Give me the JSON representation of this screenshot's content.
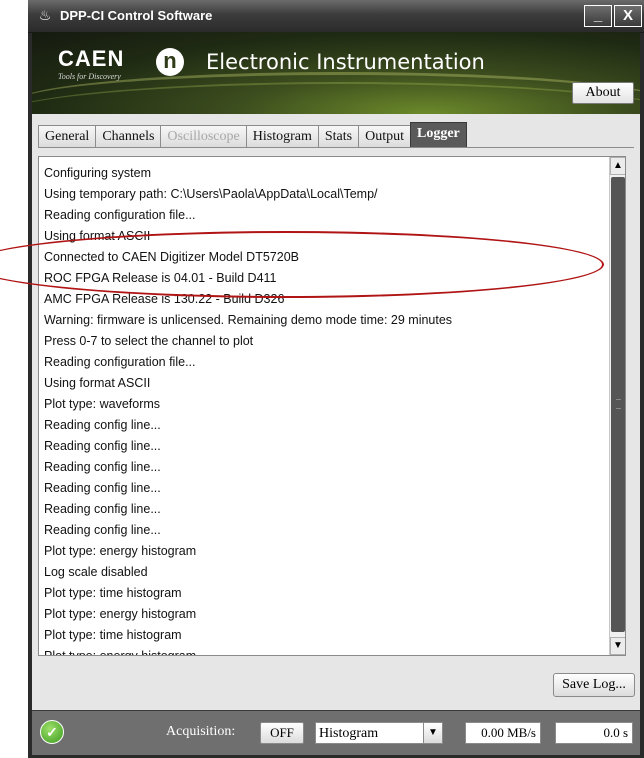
{
  "window": {
    "title": "DPP-CI Control Software",
    "icon": "caen-app-icon",
    "minimize_label": "_",
    "close_label": "X"
  },
  "banner": {
    "logo_text": "CAEN",
    "logo_tagline": "Tools for Discovery",
    "n_logo": "n",
    "title": "Electronic Instrumentation",
    "about_label": "About"
  },
  "tabs": [
    {
      "label": "General",
      "state": "normal"
    },
    {
      "label": "Channels",
      "state": "normal"
    },
    {
      "label": "Oscilloscope",
      "state": "disabled"
    },
    {
      "label": "Histogram",
      "state": "normal"
    },
    {
      "label": "Stats",
      "state": "normal"
    },
    {
      "label": "Output",
      "state": "normal"
    },
    {
      "label": "Logger",
      "state": "active"
    }
  ],
  "log": {
    "lines": [
      "Configuring system",
      "Using temporary path: C:\\Users\\Paola\\AppData\\Local\\Temp/",
      "Reading configuration file...",
      "Using format ASCII",
      "Connected to CAEN Digitizer Model DT5720B",
      "ROC FPGA Release is 04.01 - Build D411",
      "AMC FPGA Release is 130.22 - Build D326",
      "Warning: firmware is unlicensed. Remaining demo mode time: 29 minutes",
      "Press 0-7 to select the channel to plot",
      "Reading configuration file...",
      "Using format ASCII",
      "Plot type: waveforms",
      "Reading config line...",
      "Reading config line...",
      "Reading config line...",
      "Reading config line...",
      "Reading config line...",
      "Reading config line...",
      "Plot type: energy histogram",
      "Log scale disabled",
      "Plot type: time histogram",
      "Plot type: energy histogram",
      "Plot type: time histogram",
      "Plot type: energy histogram"
    ],
    "scroll_up_icon": "▲",
    "scroll_down_icon": "▼",
    "save_label": "Save Log..."
  },
  "status": {
    "ok_icon": "✓",
    "acquisition_label": "Acquisition:",
    "acquisition_state": "OFF",
    "mode_selected": "Histogram",
    "mode_arrow": "▼",
    "rate": "0.00 MB/s",
    "time": "0.0 s"
  },
  "colors": {
    "annotation_ellipse": "#b01414",
    "active_tab": "#5a5a5a",
    "statusbar": "#6f6f6f"
  }
}
